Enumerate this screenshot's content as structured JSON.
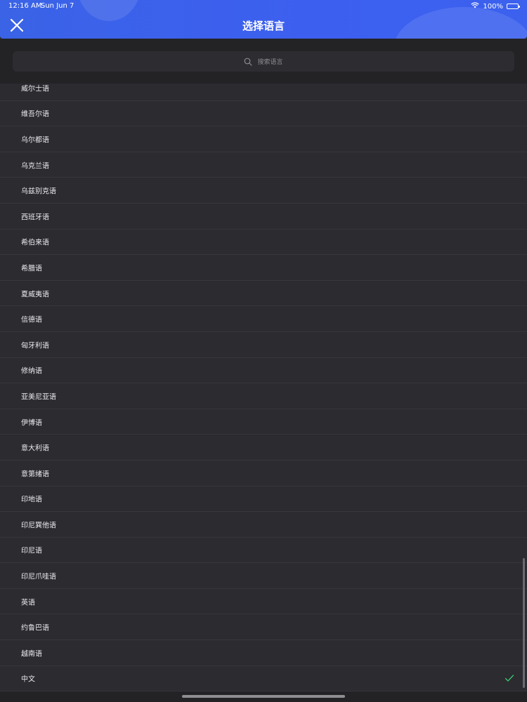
{
  "status_bar": {
    "time": "12:16 AM",
    "date": "Sun Jun 7",
    "battery": "100%",
    "icons": [
      "wifi-icon",
      "battery-icon"
    ]
  },
  "header": {
    "title": "选择语言",
    "close_icon": "close-icon",
    "accent_color": "#3d5ff0"
  },
  "search": {
    "placeholder": "搜索语言",
    "icon": "search-icon"
  },
  "languages": [
    {
      "label": "威尔士语",
      "selected": false
    },
    {
      "label": "维吾尔语",
      "selected": false
    },
    {
      "label": "乌尔都语",
      "selected": false
    },
    {
      "label": "乌克兰语",
      "selected": false
    },
    {
      "label": "乌兹别克语",
      "selected": false
    },
    {
      "label": "西班牙语",
      "selected": false
    },
    {
      "label": "希伯来语",
      "selected": false
    },
    {
      "label": "希腊语",
      "selected": false
    },
    {
      "label": "夏威夷语",
      "selected": false
    },
    {
      "label": "信德语",
      "selected": false
    },
    {
      "label": "匈牙利语",
      "selected": false
    },
    {
      "label": "修纳语",
      "selected": false
    },
    {
      "label": "亚美尼亚语",
      "selected": false
    },
    {
      "label": "伊博语",
      "selected": false
    },
    {
      "label": "意大利语",
      "selected": false
    },
    {
      "label": "意第绪语",
      "selected": false
    },
    {
      "label": "印地语",
      "selected": false
    },
    {
      "label": "印尼巽他语",
      "selected": false
    },
    {
      "label": "印尼语",
      "selected": false
    },
    {
      "label": "印尼爪哇语",
      "selected": false
    },
    {
      "label": "英语",
      "selected": false
    },
    {
      "label": "约鲁巴语",
      "selected": false
    },
    {
      "label": "越南语",
      "selected": false
    },
    {
      "label": "中文",
      "selected": true
    }
  ],
  "check_color": "#3cc36a"
}
